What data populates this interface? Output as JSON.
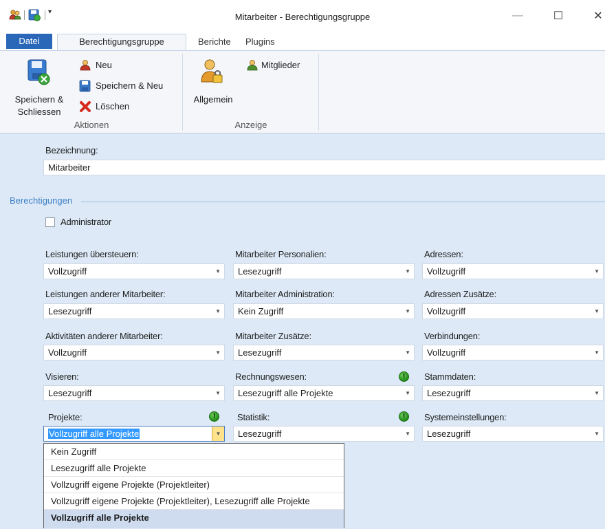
{
  "window": {
    "title": "Mitarbeiter - Berechtigungsgruppe",
    "minimize": "—",
    "maximize": "☐",
    "close": "✕"
  },
  "tabs": [
    "Datei",
    "Berechtigungsgruppe",
    "Berichte",
    "Plugins"
  ],
  "ribbon": {
    "save_close": [
      "Speichern &",
      "Schliessen"
    ],
    "neu": "Neu",
    "save_neu": "Speichern & Neu",
    "loeschen": "Löschen",
    "group_aktionen": "Aktionen",
    "allgemein": "Allgemein",
    "mitglieder": "Mitglieder",
    "group_anzeige": "Anzeige"
  },
  "form": {
    "bezeichnung_label": "Bezeichnung:",
    "bezeichnung_value": "Mitarbeiter",
    "section_title": "Berechtigungen",
    "admin_label": "Administrator",
    "admin_checked": false
  },
  "fields": {
    "leistungen_uebersteuern": {
      "label": "Leistungen übersteuern:",
      "value": "Vollzugriff"
    },
    "mitarbeiter_personalien": {
      "label": "Mitarbeiter Personalien:",
      "value": "Lesezugriff"
    },
    "adressen": {
      "label": "Adressen:",
      "value": "Vollzugriff"
    },
    "leistungen_andere": {
      "label": "Leistungen anderer Mitarbeiter:",
      "value": "Lesezugriff"
    },
    "mitarbeiter_admin": {
      "label": "Mitarbeiter Administration:",
      "value": "Kein Zugriff"
    },
    "adressen_zusaetze": {
      "label": "Adressen Zusätze:",
      "value": "Vollzugriff"
    },
    "aktivitaeten_andere": {
      "label": "Aktivitäten anderer Mitarbeiter:",
      "value": "Vollzugriff"
    },
    "mitarbeiter_zusaetze": {
      "label": "Mitarbeiter Zusätze:",
      "value": "Lesezugriff"
    },
    "verbindungen": {
      "label": "Verbindungen:",
      "value": "Vollzugriff"
    },
    "visieren": {
      "label": "Visieren:",
      "value": "Lesezugriff"
    },
    "rechnungswesen": {
      "label": "Rechnungswesen:",
      "value": "Lesezugriff alle Projekte"
    },
    "stammdaten": {
      "label": "Stammdaten:",
      "value": "Lesezugriff"
    },
    "projekte": {
      "label": "Projekte:",
      "value": "Vollzugriff alle Projekte"
    },
    "statistik": {
      "label": "Statistik:",
      "value": "Lesezugriff"
    },
    "systemeinstellungen": {
      "label": "Systemeinstellungen:",
      "value": "Lesezugriff"
    }
  },
  "dropdown_options": [
    "Kein Zugriff",
    "Lesezugriff alle Projekte",
    "Vollzugriff eigene Projekte (Projektleiter)",
    "Vollzugriff eigene Projekte (Projektleiter), Lesezugriff alle Projekte",
    "Vollzugriff alle Projekte"
  ],
  "colors": {
    "accent": "#2b67b9",
    "form_bg": "#dde9f6",
    "section_title": "#3c7fc7",
    "selection": "#3399ff"
  }
}
